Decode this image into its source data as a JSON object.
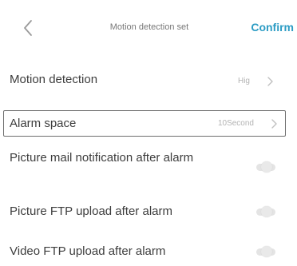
{
  "header": {
    "back_icon": "chevron-left-icon",
    "title": "Motion detection set",
    "confirm_label": "Confirm"
  },
  "settings": {
    "motion_detection": {
      "label": "Motion detection",
      "value": "Hig",
      "icon": "chevron-right-icon"
    },
    "alarm_space": {
      "label": "Alarm space",
      "value": "10Second",
      "icon": "chevron-right-icon"
    },
    "picture_mail": {
      "label": "Picture mail notification after alarm",
      "enabled": false
    },
    "picture_ftp": {
      "label": "Picture FTP upload after alarm",
      "enabled": false
    },
    "video_ftp": {
      "label": "Video FTP upload after alarm",
      "enabled": false
    }
  },
  "colors": {
    "accent": "#2c9cc4",
    "toggle_off": "#e4e4e4"
  }
}
